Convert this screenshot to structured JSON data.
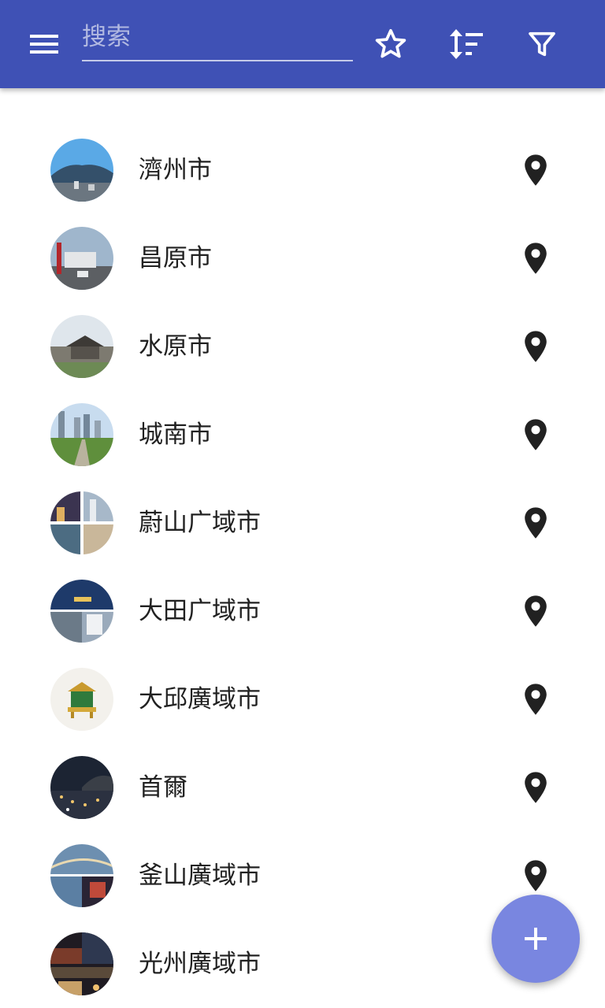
{
  "toolbar": {
    "menu_icon": "menu-icon",
    "search_placeholder": "搜索",
    "search_value": "",
    "favorites_icon": "star-outline-icon",
    "sort_icon": "sort-icon",
    "filter_icon": "filter-icon",
    "color": "#3f51b5"
  },
  "cities": [
    {
      "name": "濟州市",
      "icon": "map-pin-icon"
    },
    {
      "name": "昌原市",
      "icon": "map-pin-icon"
    },
    {
      "name": "水原市",
      "icon": "map-pin-icon"
    },
    {
      "name": "城南市",
      "icon": "map-pin-icon"
    },
    {
      "name": "蔚山广域市",
      "icon": "map-pin-icon"
    },
    {
      "name": "大田广域市",
      "icon": "map-pin-icon"
    },
    {
      "name": "大邱廣域市",
      "icon": "map-pin-icon"
    },
    {
      "name": "首爾",
      "icon": "map-pin-icon"
    },
    {
      "name": "釜山廣域市",
      "icon": "map-pin-icon"
    },
    {
      "name": "光州廣域市",
      "icon": "map-pin-icon"
    }
  ],
  "fab": {
    "icon": "plus-icon",
    "color": "#7986e0"
  }
}
